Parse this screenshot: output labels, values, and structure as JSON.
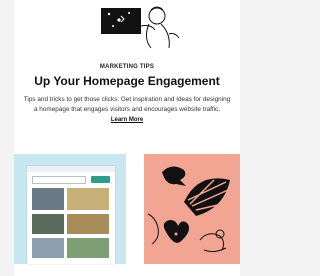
{
  "article": {
    "eyebrow": "MARKETING TIPS",
    "title": "Up Your Homepage Engagement",
    "body_line1": "Tips and tricks to get those clicks. Get inspiration and Ideas for designing",
    "body_line2": "a homepage that engages visitors and encourages website traffic.",
    "cta": "Learn More"
  },
  "colors": {
    "page_bg": "#f3f3f3",
    "card_bg": "#ffffff",
    "thumb_left_bg": "#c9e7f1",
    "thumb_right_bg": "#f2a593",
    "accent_green": "#2f9d8a"
  },
  "icons": {
    "hero": "person-with-phone-illustration",
    "thumb_right": "abstract-umbrella-bird-illustration"
  }
}
